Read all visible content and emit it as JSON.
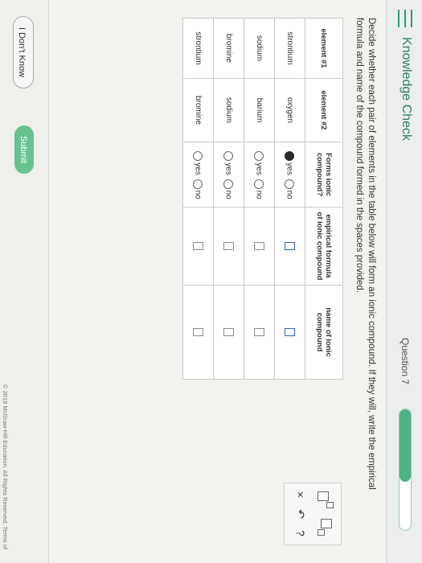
{
  "header": {
    "app_title": "Knowledge Check",
    "question_label": "Question 7",
    "progress_fraction": 0.6
  },
  "instructions": "Decide whether each pair of elements in the table below will form an ionic compound. If they will, write the empirical formula and name of the compound formed in the spaces provided.",
  "table": {
    "headers": [
      "element #1",
      "element #2",
      "Forms ionic compound?",
      "empirical formula of ionic compound",
      "name of ionic compound"
    ],
    "rows": [
      {
        "el1": "strontium",
        "el2": "oxygen",
        "yes": "yes",
        "no": "no",
        "selected": "yes"
      },
      {
        "el1": "sodium",
        "el2": "barium",
        "yes": "yes",
        "no": "no",
        "selected": ""
      },
      {
        "el1": "bromine",
        "el2": "sodium",
        "yes": "yes",
        "no": "no",
        "selected": ""
      },
      {
        "el1": "strontium",
        "el2": "bromine",
        "yes": "yes",
        "no": "no",
        "selected": ""
      }
    ]
  },
  "tools": {
    "clear": "×",
    "undo": "↶",
    "help": "?"
  },
  "footer": {
    "dont_know": "I Don't Know",
    "submit": "Submit",
    "copyright": "© 2018 McGraw-Hill Education. All Rights Reserved.   Terms of"
  },
  "colors": {
    "accent": "#4cb285",
    "title": "#2f7f5d"
  }
}
